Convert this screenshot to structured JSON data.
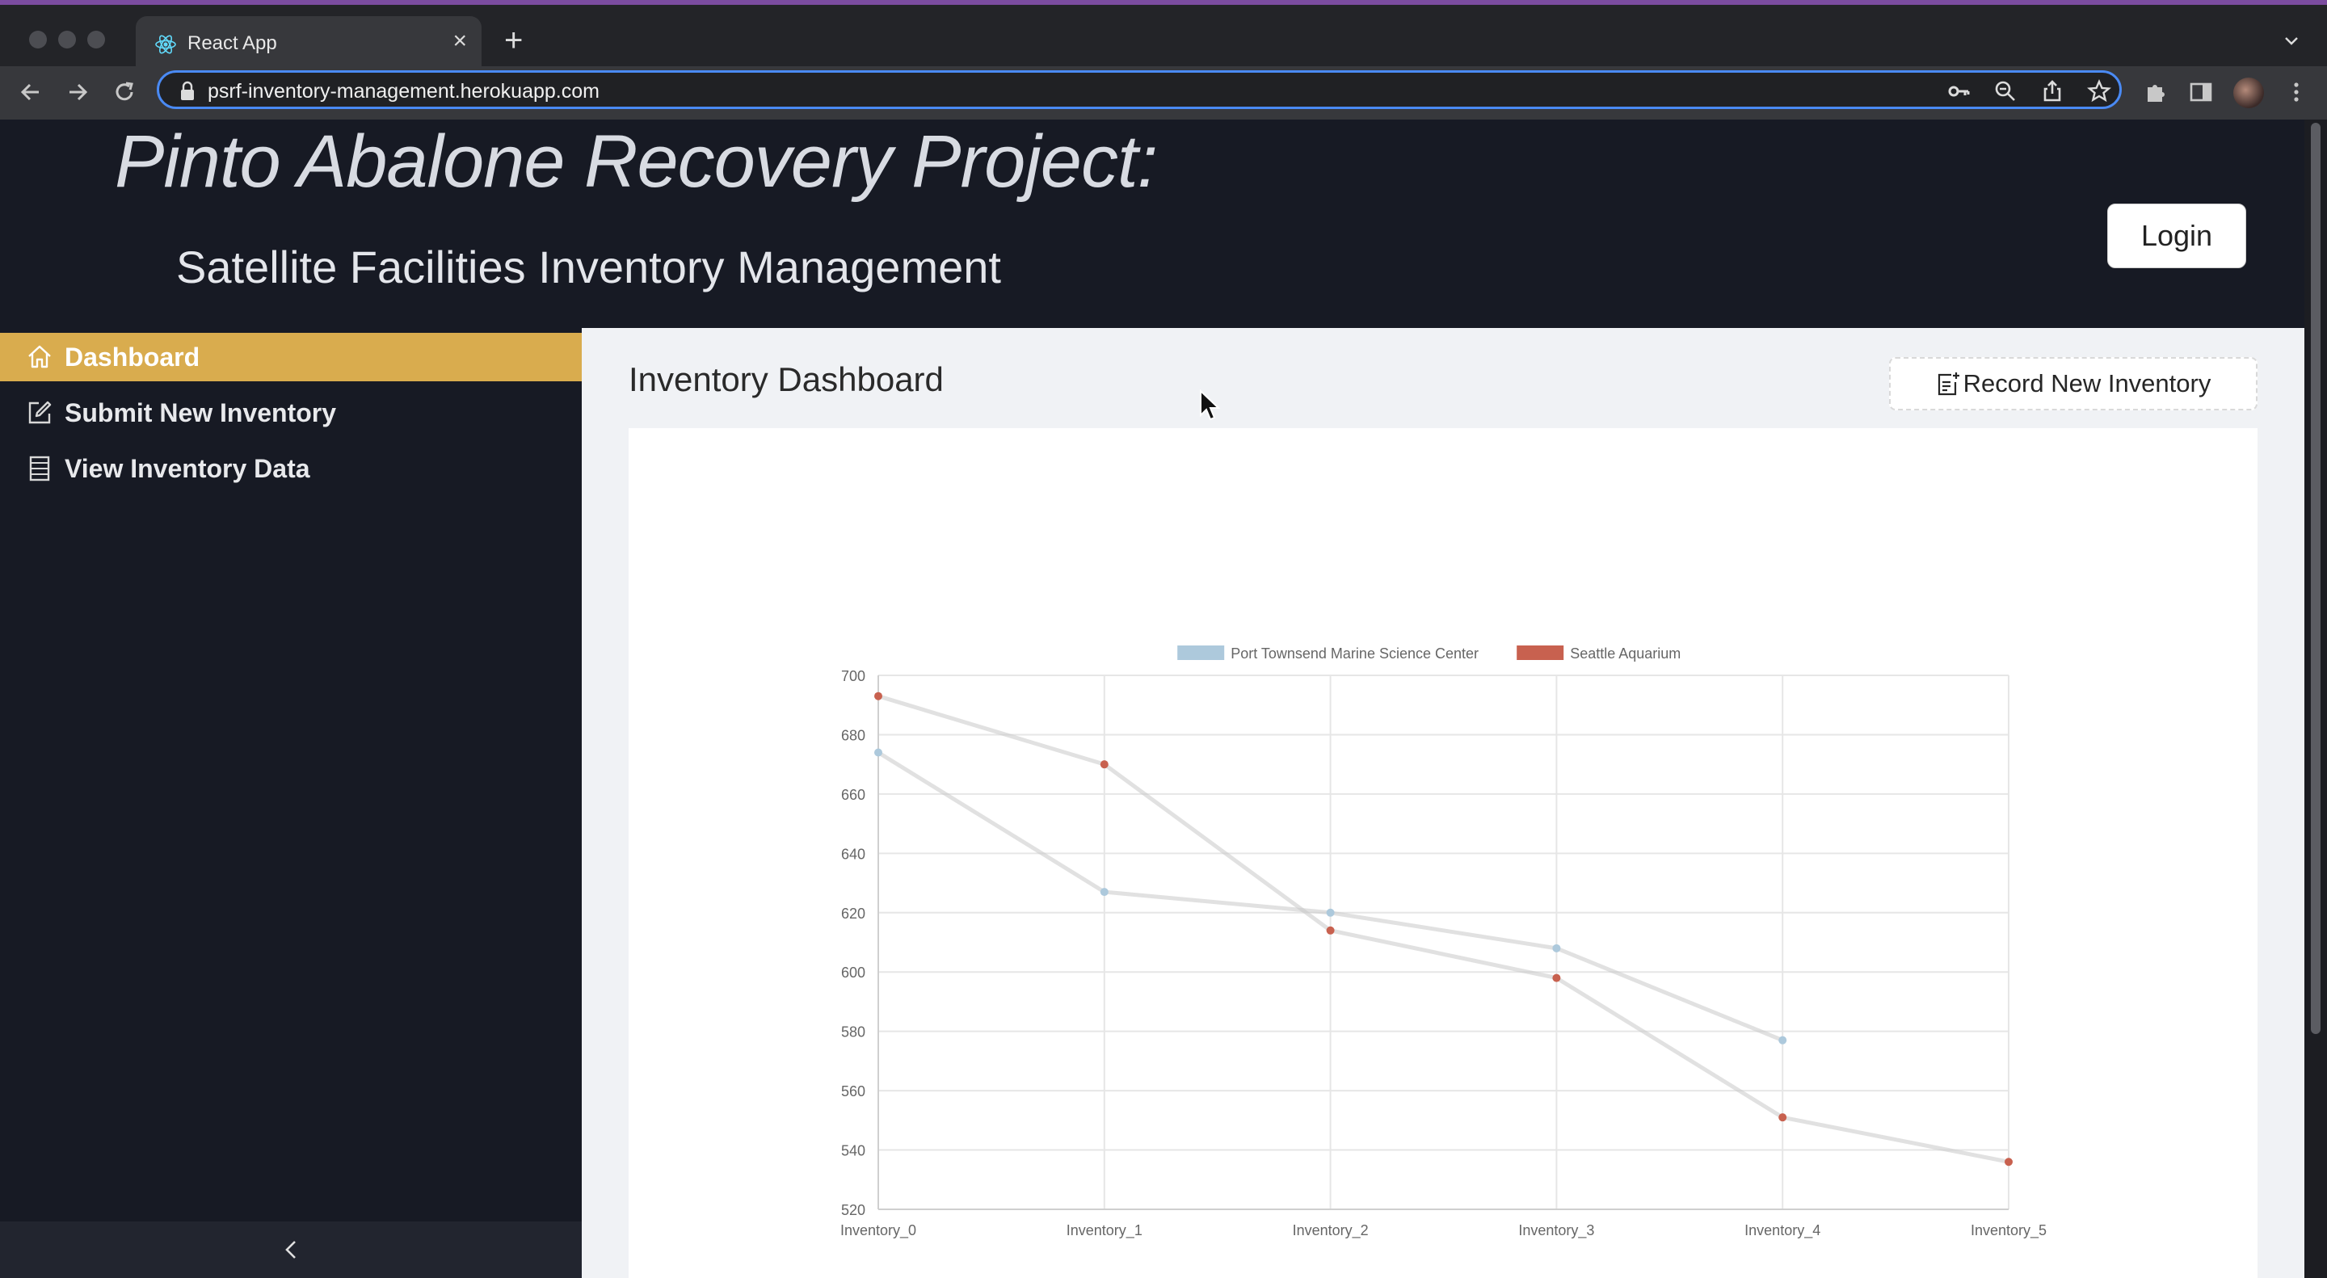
{
  "browser": {
    "tab_title": "React App",
    "url": "psrf-inventory-management.herokuapp.com",
    "icons": [
      "react-favicon",
      "close-icon",
      "plus-icon",
      "chevron-down-icon",
      "back-arrow-icon",
      "forward-arrow-icon",
      "reload-icon",
      "lock-icon",
      "key-icon",
      "zoom-icon",
      "share-icon",
      "star-icon",
      "puzzle-icon",
      "sidepanel-icon",
      "kebab-menu-icon"
    ]
  },
  "header": {
    "brand": "Pinto Abalone Recovery Project:",
    "subtitle": "Satellite Facilities Inventory Management",
    "login_label": "Login"
  },
  "sidebar": {
    "items": [
      {
        "label": "Dashboard",
        "icon": "home-icon",
        "active": true
      },
      {
        "label": "Submit New Inventory",
        "icon": "edit-icon",
        "active": false
      },
      {
        "label": "View Inventory Data",
        "icon": "list-icon",
        "active": false
      }
    ],
    "collapse_icon": "chevron-left-icon"
  },
  "main": {
    "title": "Inventory Dashboard",
    "record_button_label": "Record New Inventory"
  },
  "colors": {
    "accent": "#d9ac4e",
    "header_bg": "#171a24",
    "series_1": "#adc9dc",
    "series_2": "#c8614f"
  },
  "chart_data": {
    "type": "line",
    "categories": [
      "Inventory_0",
      "Inventory_1",
      "Inventory_2",
      "Inventory_3",
      "Inventory_4",
      "Inventory_5"
    ],
    "series": [
      {
        "name": "Port Townsend Marine Science Center",
        "values": [
          674,
          627,
          620,
          608,
          577,
          null
        ],
        "color": "#adc9dc"
      },
      {
        "name": "Seattle Aquarium",
        "values": [
          693,
          670,
          614,
          598,
          551,
          536
        ],
        "color": "#c8614f"
      }
    ],
    "ylim": [
      520,
      700
    ],
    "yticks": [
      "700",
      "680",
      "660",
      "640",
      "620",
      "600",
      "580",
      "560",
      "540",
      "520"
    ],
    "grid": true,
    "legend": "top"
  }
}
